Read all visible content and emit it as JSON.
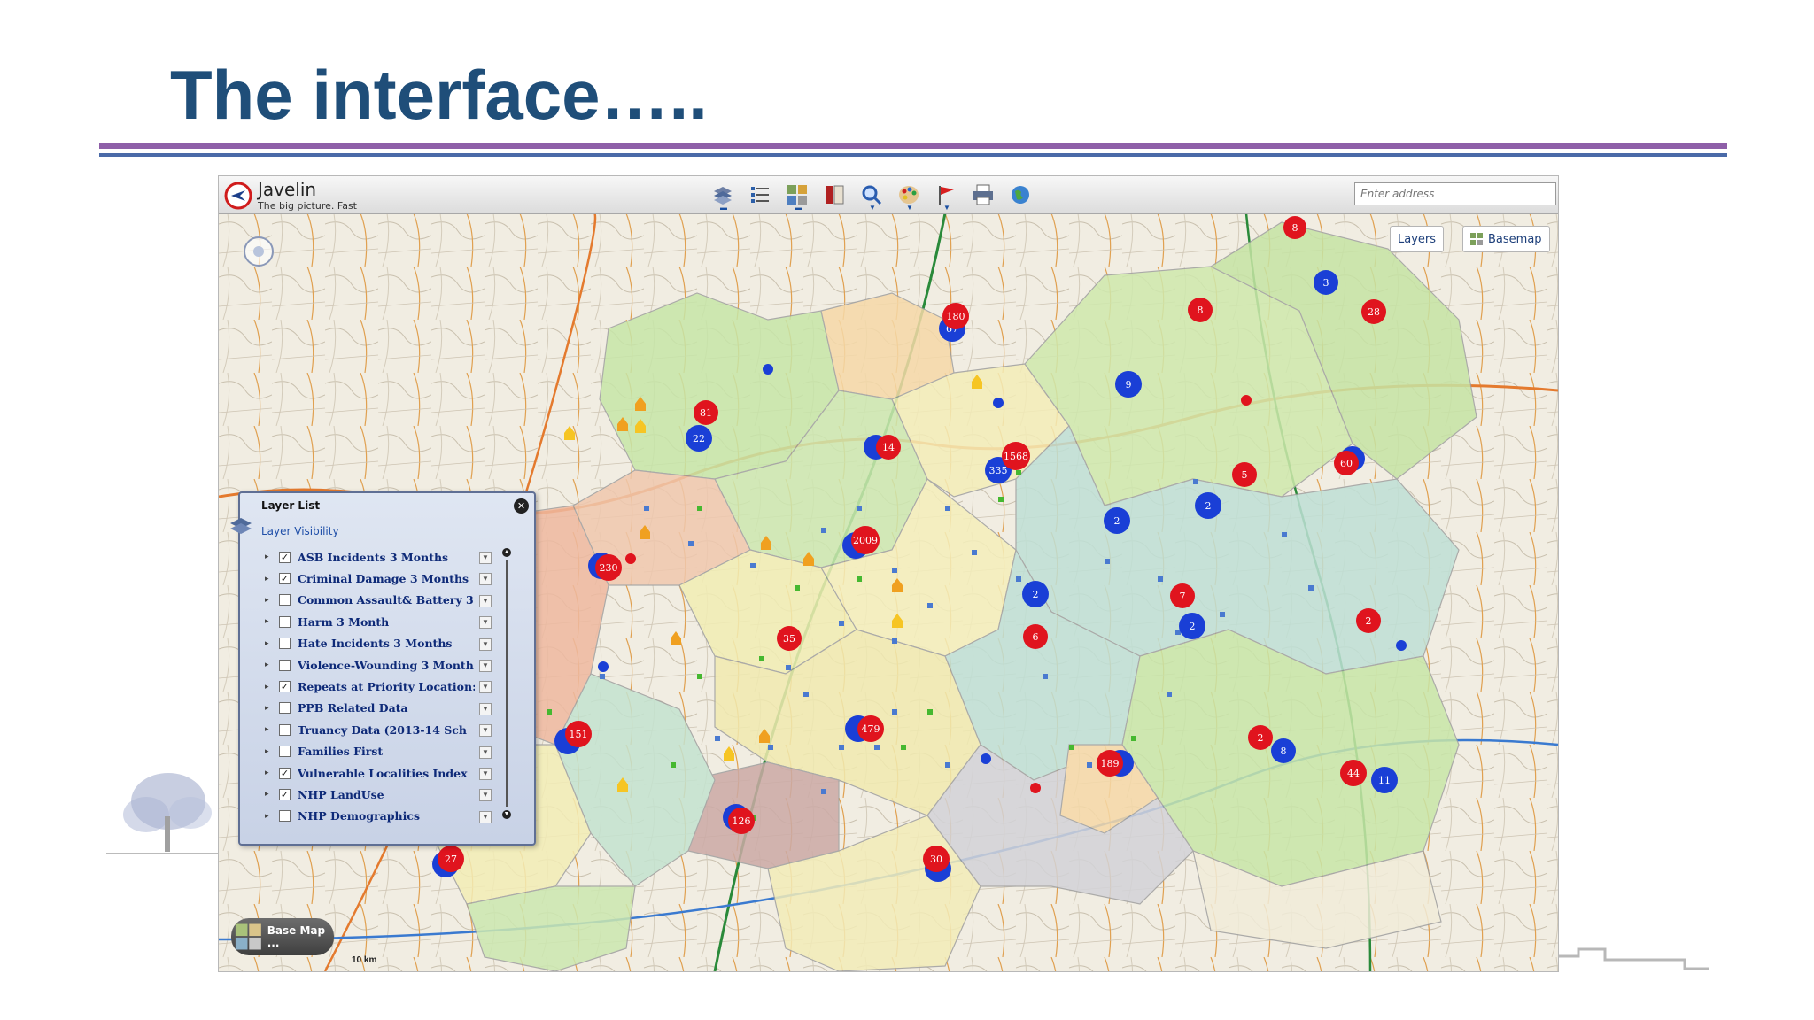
{
  "slide": {
    "title": "The interface….."
  },
  "app": {
    "name": "Javelin",
    "tagline": "The big picture. Fast",
    "address_placeholder": "Enter address",
    "toolbar_icons": [
      "layers-stack-icon",
      "list-icon",
      "grid-icon",
      "book-icon",
      "search-icon",
      "palette-icon",
      "flag-icon",
      "print-icon",
      "globe-icon"
    ]
  },
  "map_buttons": {
    "layers": "Layers",
    "basemap": "Basemap"
  },
  "layer_panel": {
    "title": "Layer List",
    "subtitle": "Layer Visibility",
    "layers": [
      {
        "label": "ASB Incidents 3 Months",
        "checked": true
      },
      {
        "label": "Criminal Damage 3 Months",
        "checked": true
      },
      {
        "label": "Common Assault& Battery 3",
        "checked": false
      },
      {
        "label": "Harm 3 Month",
        "checked": false
      },
      {
        "label": "Hate Incidents 3 Months",
        "checked": false
      },
      {
        "label": "Violence-Wounding 3 Month",
        "checked": false
      },
      {
        "label": "Repeats at Priority Location:",
        "checked": true
      },
      {
        "label": "PPB Related Data",
        "checked": false
      },
      {
        "label": "Truancy Data (2013-14 Sch",
        "checked": false
      },
      {
        "label": "Families First",
        "checked": false
      },
      {
        "label": "Vulnerable Localities Index",
        "checked": true
      },
      {
        "label": "NHP LandUse",
        "checked": true
      },
      {
        "label": "NHP Demographics",
        "checked": false
      }
    ]
  },
  "base_map_label": "Base Map ...",
  "scale_label": "10 km",
  "map_markers": {
    "red": [
      "8",
      "28",
      "8",
      "180",
      "81",
      "14",
      "1568",
      "60",
      "5",
      "2009",
      "230",
      "7",
      "2",
      "35",
      "6",
      "151",
      "479",
      "2",
      "189",
      "44",
      "126",
      "30",
      "27"
    ],
    "blue": [
      "3",
      "9",
      "67",
      "22",
      "335",
      "2",
      "2",
      "2",
      "2",
      "8",
      "11"
    ]
  },
  "colors": {
    "title": "#1f4e79",
    "rule_purple": "#8e5fa8",
    "rule_blue": "#4a6aa8",
    "marker_red": "#e0141e",
    "marker_blue": "#1a3fd6"
  }
}
